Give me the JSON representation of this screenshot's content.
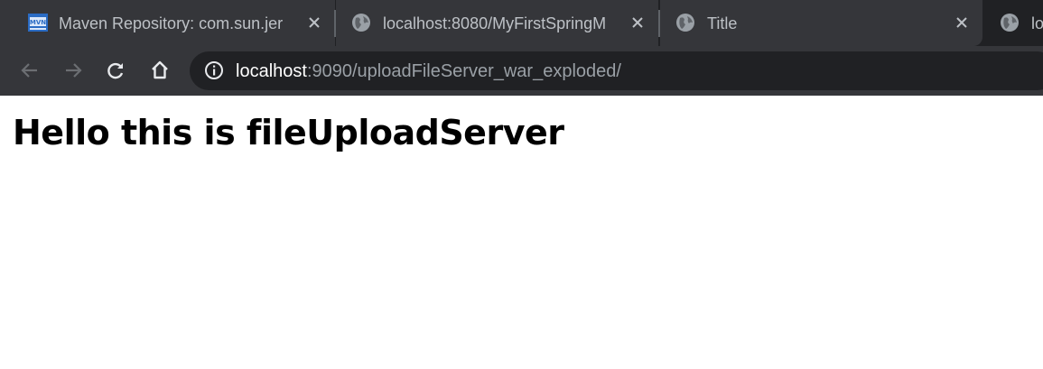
{
  "tabs": [
    {
      "title": "Maven Repository: com.sun.jer",
      "favicon": "mvn-repository-icon",
      "active": false
    },
    {
      "title": "localhost:8080/MyFirstSpringM",
      "favicon": "globe-icon",
      "active": false
    },
    {
      "title": "Title",
      "favicon": "globe-icon",
      "active": true
    },
    {
      "title": "lo",
      "favicon": "globe-icon",
      "active": false
    }
  ],
  "address_bar": {
    "host": "localhost",
    "rest": ":9090/uploadFileServer_war_exploded/"
  },
  "page": {
    "heading": "Hello this is fileUploadServer"
  },
  "colors": {
    "tabstrip_bg": "#202124",
    "toolbar_bg": "#35363a",
    "omnibox_bg": "#202124",
    "url_host": "#ffffff",
    "url_rest": "#9aa0a6",
    "tab_text": "#bdc1c6"
  }
}
